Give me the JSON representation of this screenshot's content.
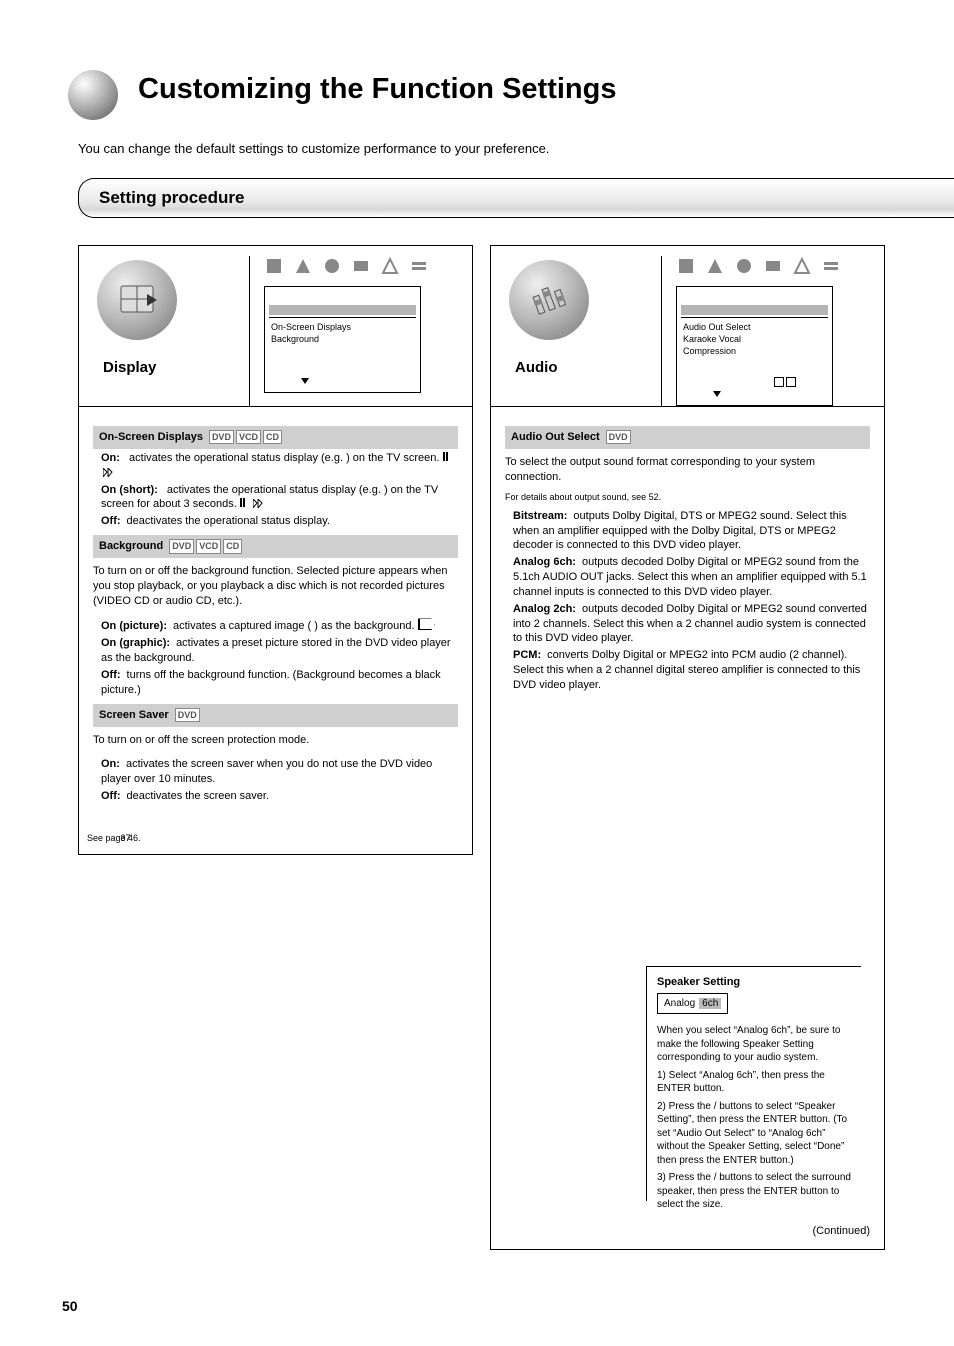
{
  "page": {
    "number": "50",
    "title": "Customizing the Function Settings",
    "subtitle": "You can change the default settings to customize performance to your preference.",
    "ribbon": "Setting procedure"
  },
  "left": {
    "heading": "Display",
    "osd_preview": {
      "row1": "On-Screen Displays",
      "row2": "Background"
    },
    "items": [
      {
        "title": "On-Screen Displays",
        "tags": [
          "DVD",
          "VCD",
          "CD"
        ],
        "opts": [
          {
            "k": "On:",
            "v": "activates the operational status display (e.g.         ) on the TV screen."
          },
          {
            "k": "On (short):",
            "v": "activates the operational status display (e.g.         ) on the TV screen for about 3 seconds."
          },
          {
            "k": "Off:",
            "v": "deactivates the operational status display."
          }
        ]
      },
      {
        "title": "Background",
        "tags": [
          "DVD",
          "VCD",
          "CD"
        ],
        "desc": "To turn on or off the background function. Selected picture appears when you stop playback, or you playback a disc which is not recorded pictures (VIDEO CD or audio CD, etc.).",
        "opts": [
          {
            "k": "On (picture):",
            "v": "activates a captured image (       ) as the background."
          },
          {
            "k": "On (graphic):",
            "v": "activates a preset picture stored in the DVD video player as the background."
          },
          {
            "k": "Off:",
            "v": "turns off the background function. (Background becomes a black picture.)"
          }
        ]
      },
      {
        "title": "Screen Saver",
        "tags": [
          "DVD"
        ],
        "desc": "To turn on or off the screen protection mode.",
        "opts": [
          {
            "k": "On:",
            "v": "activates the screen saver when you do not use the DVD video player over 10 minutes."
          },
          {
            "k": "Off:",
            "v": "deactivates the screen saver."
          }
        ]
      }
    ],
    "page_ref": "See page 46.",
    "see_marker_ref": "37"
  },
  "right": {
    "heading": "Audio",
    "osd_preview": {
      "row1": "Audio Out Select",
      "row2": "Karaoke Vocal",
      "row3": "Compression"
    },
    "items": [
      {
        "title": "Audio Out Select",
        "tags": [
          "DVD"
        ],
        "desc": "To select the output sound format corresponding to your system connection.",
        "lead": "For details about output sound, see",
        "opts": [
          {
            "k": "Bitstream:",
            "v": "outputs Dolby Digital, DTS or MPEG2 sound. Select this when an amplifier equipped with the Dolby Digital, DTS or MPEG2 decoder is connected to this DVD video player."
          },
          {
            "k": "Analog 6ch:",
            "v": "outputs decoded Dolby Digital or MPEG2 sound from the 5.1ch AUDIO OUT jacks. Select this when an amplifier equipped with 5.1 channel inputs is connected to this DVD video player."
          },
          {
            "k": "Analog 2ch:",
            "v": "outputs decoded Dolby Digital or MPEG2 sound converted into 2 channels. Select this when a 2 channel audio system is connected to this DVD video player."
          },
          {
            "k": "PCM:",
            "v": "converts Dolby Digital or MPEG2 into PCM audio (2 channel). Select this when a 2 channel digital stereo amplifier is connected to this DVD video player."
          }
        ]
      }
    ],
    "sub_osd": {
      "title": "Speaker Setting",
      "io_label": "Analog",
      "io_value": "6ch",
      "p1": "When you select “Analog 6ch”, be sure to make the following Speaker Setting corresponding to your audio system.",
      "steps": [
        "1) Select “Analog 6ch”, then press the ENTER button.",
        "2) Press the     /     buttons to select “Speaker Setting”, then press the ENTER button. (To set “Audio Out Select” to “Analog 6ch” without the Speaker Setting, select “Done” then press the ENTER button.)",
        "3) Press the     /     buttons to select the surround speaker, then press the ENTER button to select the size."
      ],
      "cont": "(Continued)"
    },
    "page_ref": "52"
  }
}
